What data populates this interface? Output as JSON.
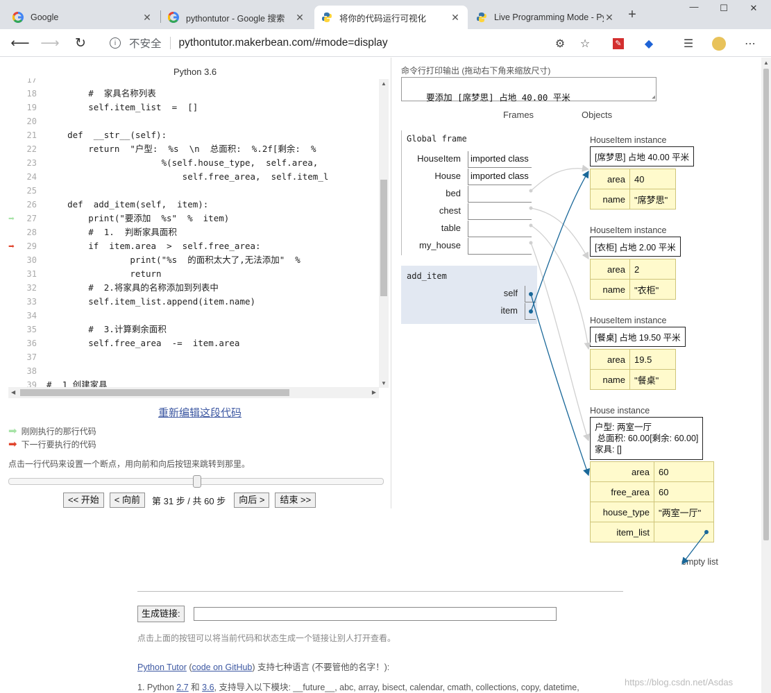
{
  "browser": {
    "tabs": [
      {
        "label": "Google",
        "icon": "google-icon",
        "active": false
      },
      {
        "label": "pythontutor - Google 搜索",
        "icon": "google-icon",
        "active": false
      },
      {
        "label": "将你的代码运行可视化",
        "icon": "python-icon",
        "active": true
      },
      {
        "label": "Live Programming Mode - Py",
        "icon": "python-icon",
        "active": false
      }
    ],
    "security_label": "不安全",
    "url": "pythontutor.makerbean.com/#mode=display"
  },
  "editor": {
    "language": "Python 3.6",
    "lines": [
      {
        "n": "17",
        "code": "",
        "marker": ""
      },
      {
        "n": "18",
        "code": "        #  家具名称列表",
        "marker": ""
      },
      {
        "n": "19",
        "code": "        self.item_list  =  []",
        "marker": ""
      },
      {
        "n": "20",
        "code": "",
        "marker": ""
      },
      {
        "n": "21",
        "code": "    def  __str__(self):",
        "marker": ""
      },
      {
        "n": "22",
        "code": "        return  \"户型:  %s  \\n  总面积:  %.2f[剩余:  %",
        "marker": ""
      },
      {
        "n": "23",
        "code": "                      %(self.house_type,  self.area,",
        "marker": ""
      },
      {
        "n": "24",
        "code": "                          self.free_area,  self.item_l",
        "marker": ""
      },
      {
        "n": "25",
        "code": "",
        "marker": ""
      },
      {
        "n": "26",
        "code": "    def  add_item(self,  item):",
        "marker": ""
      },
      {
        "n": "27",
        "code": "        print(\"要添加  %s\"  %  item)",
        "marker": "prev"
      },
      {
        "n": "28",
        "code": "        #  1.  判断家具面积",
        "marker": ""
      },
      {
        "n": "29",
        "code": "        if  item.area  >  self.free_area:",
        "marker": "next"
      },
      {
        "n": "30",
        "code": "                print(\"%s  的面积太大了,无法添加\"  %",
        "marker": ""
      },
      {
        "n": "31",
        "code": "                return",
        "marker": ""
      },
      {
        "n": "32",
        "code": "        #  2.将家具的名称添加到列表中",
        "marker": ""
      },
      {
        "n": "33",
        "code": "        self.item_list.append(item.name)",
        "marker": ""
      },
      {
        "n": "34",
        "code": "",
        "marker": ""
      },
      {
        "n": "35",
        "code": "        #  3.计算剩余面积",
        "marker": ""
      },
      {
        "n": "36",
        "code": "        self.free_area  -=  item.area",
        "marker": ""
      },
      {
        "n": "37",
        "code": "",
        "marker": ""
      },
      {
        "n": "38",
        "code": "",
        "marker": ""
      },
      {
        "n": "39",
        "code": "#  1 创建家具",
        "marker": ""
      }
    ],
    "edit_link": "重新编辑这段代码",
    "legend_prev": "刚刚执行的那行代码",
    "legend_next": "下一行要执行的代码",
    "hint": "点击一行代码来设置一个断点，用向前和向后按钮来跳转到那里。",
    "slider_position": 0.5,
    "buttons": {
      "first": "<< 开始",
      "back": "< 向前",
      "forward": "向后 >",
      "last": "结束 >>"
    },
    "step_info": "第 31 步 / 共 60 步",
    "colors": {
      "prev_arrow": "#a6e3a6",
      "next_arrow": "#e0432b"
    }
  },
  "viz": {
    "stdout_label": "命令行打印输出 (拖动右下角来缩放尺寸)",
    "stdout_text": "要添加 [席梦思] 占地 40.00 平米",
    "frames_header": "Frames",
    "objects_header": "Objects",
    "global_frame_title": "Global frame",
    "global_vars": [
      {
        "name": "HouseItem",
        "value": "imported class"
      },
      {
        "name": "House",
        "value": "imported class"
      },
      {
        "name": "bed",
        "value": ""
      },
      {
        "name": "chest",
        "value": ""
      },
      {
        "name": "table",
        "value": ""
      },
      {
        "name": "my_house",
        "value": ""
      }
    ],
    "stack_frame_title": "add_item",
    "stack_vars": [
      {
        "name": "self"
      },
      {
        "name": "item"
      }
    ],
    "objects": [
      {
        "title": "HouseItem instance",
        "str": "[席梦思] 占地 40.00 平米",
        "fields": [
          {
            "k": "area",
            "v": "40"
          },
          {
            "k": "name",
            "v": "\"席梦思\""
          }
        ]
      },
      {
        "title": "HouseItem instance",
        "str": "[衣柜] 占地 2.00 平米",
        "fields": [
          {
            "k": "area",
            "v": "2"
          },
          {
            "k": "name",
            "v": "\"衣柜\""
          }
        ]
      },
      {
        "title": "HouseItem instance",
        "str": "[餐桌] 占地 19.50 平米",
        "fields": [
          {
            "k": "area",
            "v": "19.5"
          },
          {
            "k": "name",
            "v": "\"餐桌\""
          }
        ]
      },
      {
        "title": "House instance",
        "str": "户型: 两室一厅\n 总面积: 60.00[剩余: 60.00]\n家具: []",
        "fields": [
          {
            "k": "area",
            "v": "60"
          },
          {
            "k": "free_area",
            "v": "60"
          },
          {
            "k": "house_type",
            "v": "\"两室一厅\""
          },
          {
            "k": "item_list",
            "v": ""
          }
        ]
      }
    ],
    "empty_list_label": "empty list",
    "pointer_color": "#1a6899"
  },
  "footer": {
    "gen_button": "生成链接:",
    "gen_note": "点击上面的按钮可以将当前代码和状态生成一个链接让别人打开查看。",
    "line1_link": "Python Tutor",
    "line1_paren_open": " (",
    "line1_code_link": "code on GitHub",
    "line1_rest": ") 支持七种语言 (不要管他的名字！):",
    "line2_prefix": "1. Python ",
    "line2_v27": "2.7",
    "line2_and": " 和 ",
    "line2_v36": "3.6",
    "line2_rest": ", 支持导入以下模块: __future__, abc, array, bisect, calendar, cmath, collections, copy, datetime,",
    "watermark": "https://blog.csdn.net/Asdas"
  }
}
